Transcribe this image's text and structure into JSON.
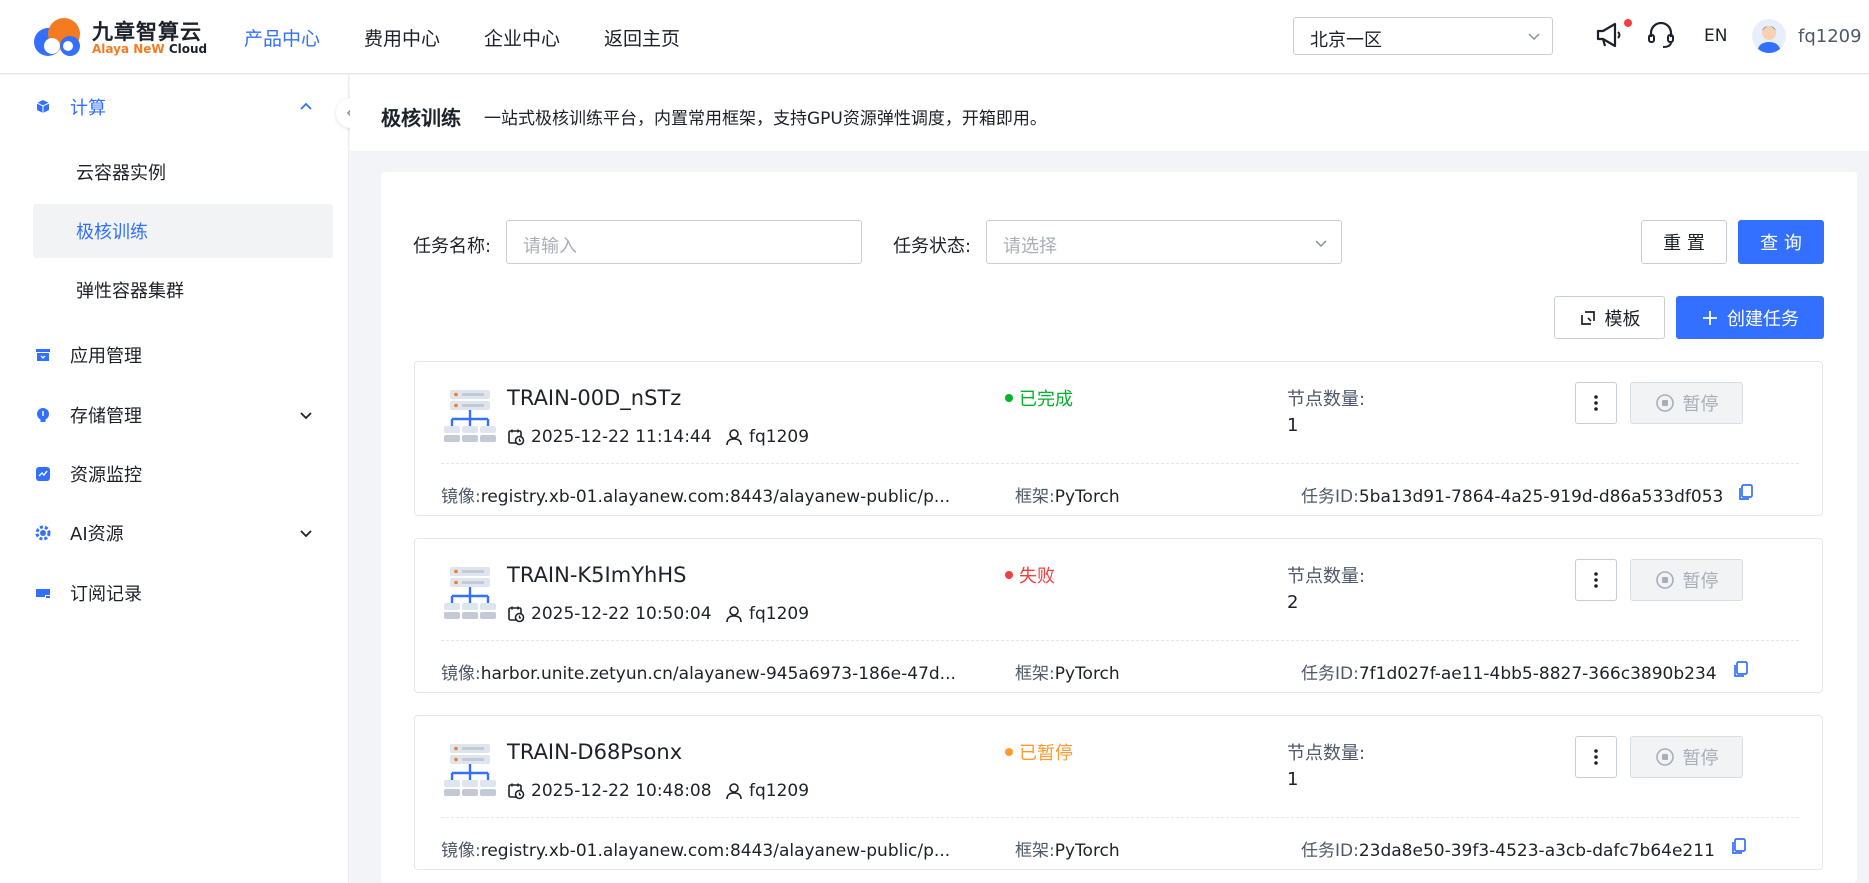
{
  "header": {
    "logo_cn": "九章智算云",
    "logo_en_1": "Alaya NeW",
    "logo_en_2": "Cloud",
    "nav": [
      "产品中心",
      "费用中心",
      "企业中心",
      "返回主页"
    ],
    "region": "北京一区",
    "lang": "EN",
    "username": "fq1209"
  },
  "sidebar": {
    "compute": "计算",
    "container_instance": "云容器实例",
    "training": "极核训练",
    "elastic_cluster": "弹性容器集群",
    "app_mgmt": "应用管理",
    "storage_mgmt": "存储管理",
    "monitoring": "资源监控",
    "ai_resources": "AI资源",
    "subscriptions": "订阅记录"
  },
  "page": {
    "title": "极核训练",
    "description": "一站式极核训练平台，内置常用框架，支持GPU资源弹性调度，开箱即用。"
  },
  "filters": {
    "task_name_label": "任务名称:",
    "task_name_placeholder": "请输入",
    "task_status_label": "任务状态:",
    "task_status_placeholder": "请选择",
    "reset": "重 置",
    "query": "查 询",
    "template": "模板",
    "create": "创建任务"
  },
  "labels": {
    "node_count": "节点数量:",
    "image": "镜像:",
    "framework": "框架:",
    "task_id": "任务ID:",
    "pause": "暂停"
  },
  "tasks": [
    {
      "name": "TRAIN-00D_nSTz",
      "time": "2025-12-22 11:14:44",
      "user": "fq1209",
      "status": "已完成",
      "status_color": "#00b42a",
      "nodes": "1",
      "image": "registry.xb-01.alayanew.com:8443/alayanew-public/p...",
      "framework": "PyTorch",
      "task_id": "5ba13d91-7864-4a25-919d-d86a533df053"
    },
    {
      "name": "TRAIN-K5ImYhHS",
      "time": "2025-12-22 10:50:04",
      "user": "fq1209",
      "status": "失败",
      "status_color": "#f53f3f",
      "nodes": "2",
      "image": "harbor.unite.zetyun.cn/alayanew-945a6973-186e-47d...",
      "framework": "PyTorch",
      "task_id": "7f1d027f-ae11-4bb5-8827-366c3890b234"
    },
    {
      "name": "TRAIN-D68Psonx",
      "time": "2025-12-22 10:48:08",
      "user": "fq1209",
      "status": "已暂停",
      "status_color": "#ff9a2e",
      "nodes": "1",
      "image": "registry.xb-01.alayanew.com:8443/alayanew-public/p...",
      "framework": "PyTorch",
      "task_id": "23da8e50-39f3-4523-a3cb-dafc7b64e211"
    }
  ],
  "colors": {
    "primary": "#3370ff",
    "logo_orange": "#f47b20"
  }
}
